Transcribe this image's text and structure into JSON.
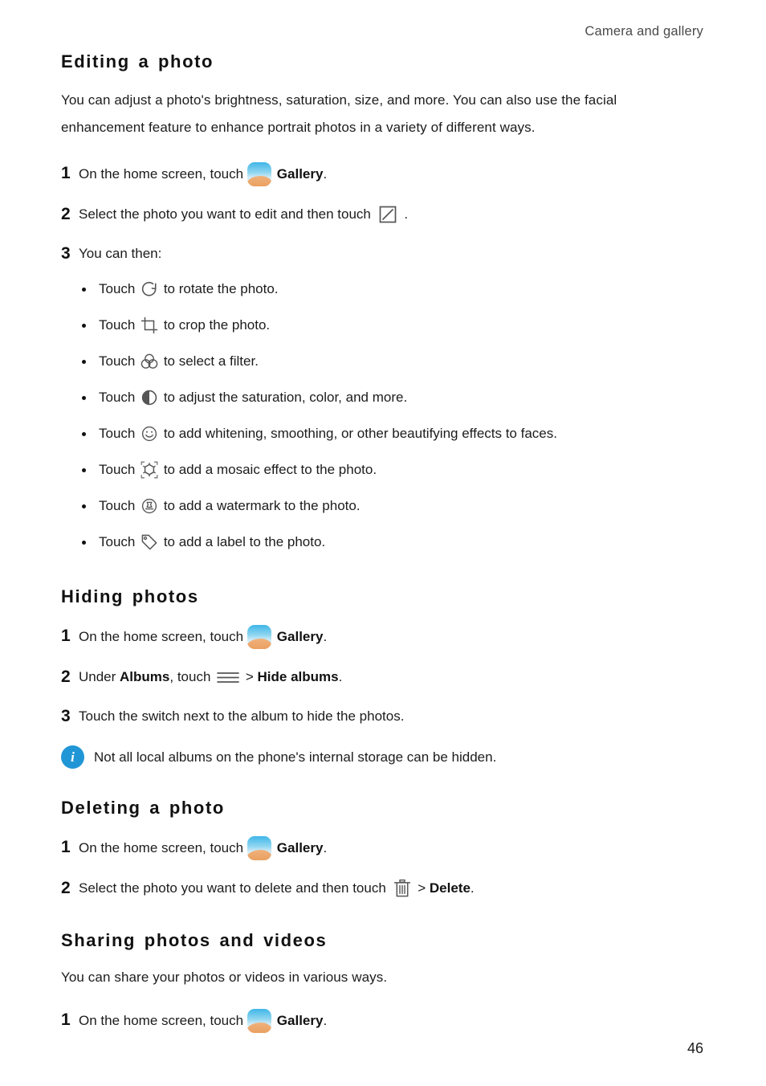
{
  "header": {
    "running_title": "Camera and gallery"
  },
  "sections": [
    {
      "id": "editing-a-photo",
      "title": "Editing a photo",
      "intro": "You can adjust a photo's brightness, saturation, size, and more. You can also use the facial enhancement feature to enhance portrait photos in a variety of different ways.",
      "steps": [
        {
          "num": "1",
          "before": "On the home screen, touch ",
          "icon": "gallery-icon",
          "bold": "Gallery",
          "after": "."
        },
        {
          "num": "2",
          "before": "Select the photo you want to edit and then touch ",
          "icon": "edit-square-icon",
          "after": " ."
        },
        {
          "num": "3",
          "before": "You can then:"
        }
      ],
      "bullets": [
        {
          "before": "Touch ",
          "icon": "rotate-icon",
          "after": " to rotate the photo."
        },
        {
          "before": "Touch ",
          "icon": "crop-icon",
          "after": " to crop the photo."
        },
        {
          "before": "Touch ",
          "icon": "filter-icon",
          "after": " to select a filter."
        },
        {
          "before": "Touch ",
          "icon": "contrast-icon",
          "after": " to adjust the saturation, color, and more."
        },
        {
          "before": "Touch ",
          "icon": "smiley-icon",
          "after": " to add whitening, smoothing, or other beautifying effects to faces."
        },
        {
          "before": "Touch ",
          "icon": "mosaic-icon",
          "after": " to add a mosaic effect to the photo."
        },
        {
          "before": "Touch ",
          "icon": "watermark-icon",
          "after": " to add a watermark to the photo."
        },
        {
          "before": "Touch ",
          "icon": "label-tag-icon",
          "after": " to add a label to the photo."
        }
      ]
    },
    {
      "id": "hiding-photos",
      "title": "Hiding photos",
      "steps": [
        {
          "num": "1",
          "before": "On the home screen, touch ",
          "icon": "gallery-icon",
          "bold": "Gallery",
          "after": "."
        },
        {
          "num": "2",
          "before": "Under ",
          "bold_mid": "Albums",
          "middle": ", touch ",
          "icon": "hamburger-menu-icon",
          "separator": " > ",
          "bold": "Hide albums",
          "after": "."
        },
        {
          "num": "3",
          "before": "Touch the switch next to the album to hide the photos."
        }
      ],
      "note": {
        "icon": "info-icon",
        "text": "Not all local albums on the phone's internal storage can be hidden."
      }
    },
    {
      "id": "deleting-a-photo",
      "title": "Deleting a photo",
      "steps": [
        {
          "num": "1",
          "before": "On the home screen, touch ",
          "icon": "gallery-icon",
          "bold": "Gallery",
          "after": "."
        },
        {
          "num": "2",
          "before": "Select the photo you want to delete and then touch ",
          "icon": "trash-icon",
          "separator": " > ",
          "bold": "Delete",
          "after": "."
        }
      ]
    },
    {
      "id": "sharing-photos-and-videos",
      "title": "Sharing photos and videos",
      "intro": "You can share your photos or videos in various ways.",
      "steps": [
        {
          "num": "1",
          "before": "On the home screen, touch ",
          "icon": "gallery-icon",
          "bold": "Gallery",
          "after": "."
        }
      ]
    }
  ],
  "footer": {
    "page_number": "46"
  },
  "colors": {
    "info_badge": "#2196d6",
    "icon_stroke": "#555555",
    "text": "#1c1c1c",
    "gallery_sky": "#3fb6e8",
    "gallery_sand": "#e89b58"
  }
}
